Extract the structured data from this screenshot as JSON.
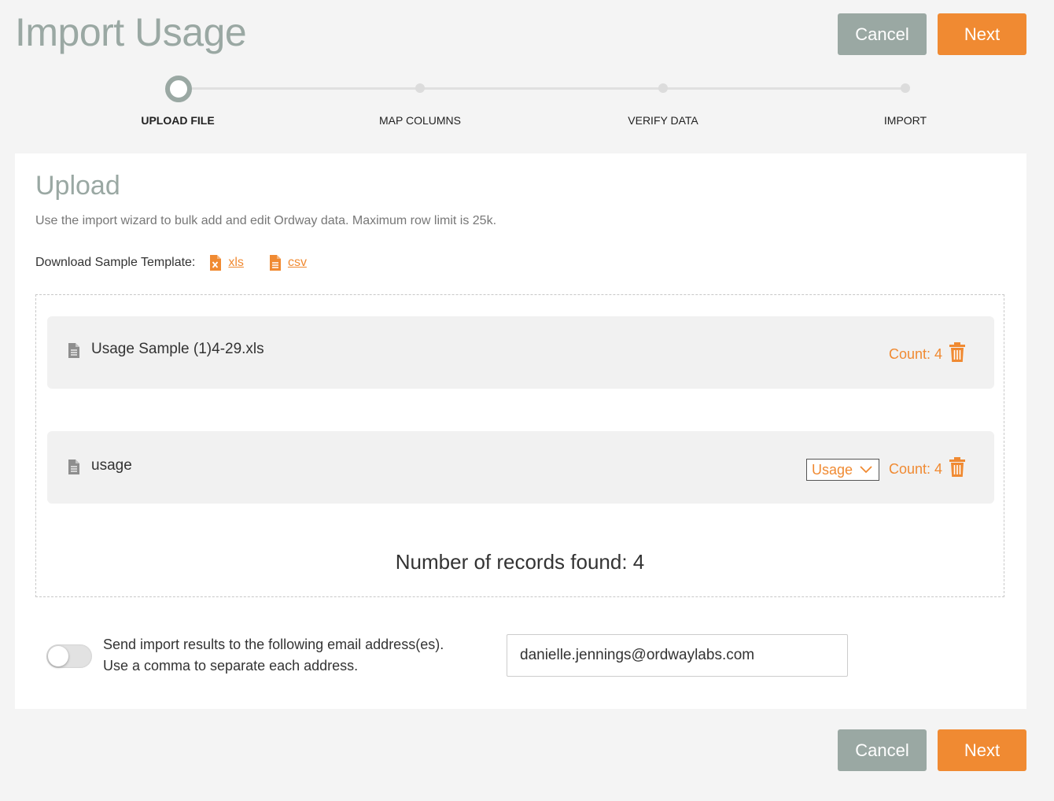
{
  "page": {
    "title": "Import Usage"
  },
  "actions": {
    "cancel_label": "Cancel",
    "next_label": "Next"
  },
  "stepper": {
    "steps": [
      {
        "label": "UPLOAD FILE",
        "active": true
      },
      {
        "label": "MAP COLUMNS",
        "active": false
      },
      {
        "label": "VERIFY DATA",
        "active": false
      },
      {
        "label": "IMPORT",
        "active": false
      }
    ]
  },
  "upload": {
    "title": "Upload",
    "description": "Use the import wizard to bulk add and edit Ordway data. Maximum row limit is 25k.",
    "template_label": "Download Sample Template:",
    "templates": [
      {
        "label": "xls"
      },
      {
        "label": "csv"
      }
    ],
    "files": [
      {
        "name": "Usage Sample (1)4-29.xls",
        "count_label": "Count: 4"
      },
      {
        "name": "usage",
        "sheet_type": "Usage",
        "count_label": "Count: 4"
      }
    ],
    "records_found": "Number of records found: 4"
  },
  "email": {
    "label_line1": "Send import results to the following email address(es).",
    "label_line2": "Use a comma to separate each address.",
    "value": "danielle.jennings@ordwaylabs.com",
    "toggle_on": false
  },
  "colors": {
    "accent": "#f08a32",
    "muted": "#9aa8a3"
  }
}
